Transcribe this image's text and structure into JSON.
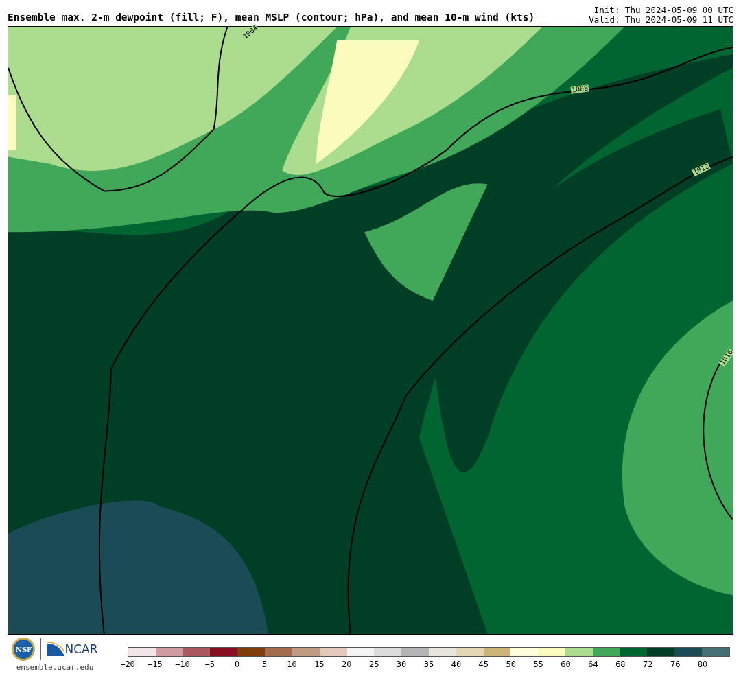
{
  "header": {
    "title": "Ensemble max. 2-m dewpoint (fill; F), mean MSLP (contour; hPa), and mean 10-m wind (kts)",
    "init": "Init: Thu 2024-05-09 00 UTC",
    "valid": "Valid: Thu 2024-05-09 11 UTC"
  },
  "map": {
    "contour_labels": [
      "1004",
      "1008",
      "1012",
      "1016"
    ]
  },
  "footer": {
    "nsf_logo": "NSF",
    "ncar_logo": "NCAR",
    "site": "ensemble.ucar.edu"
  },
  "colorbar": {
    "segments": [
      {
        "color": "#f3e6e8"
      },
      {
        "color": "#cf9aa0"
      },
      {
        "color": "#a85a5f"
      },
      {
        "color": "#870f1f"
      },
      {
        "color": "#7f3c0c"
      },
      {
        "color": "#a36c4a"
      },
      {
        "color": "#c19a82"
      },
      {
        "color": "#e2c9bb"
      },
      {
        "color": "#f4f4f4"
      },
      {
        "color": "#dcdcdc"
      },
      {
        "color": "#b5b5b5"
      },
      {
        "color": "#e6e6dc"
      },
      {
        "color": "#e6d7b4"
      },
      {
        "color": "#cdb478"
      },
      {
        "color": "#fffedc"
      },
      {
        "color": "#fafcbe"
      },
      {
        "color": "#acdc8e"
      },
      {
        "color": "#41a85a"
      },
      {
        "color": "#006530"
      },
      {
        "color": "#003f26"
      },
      {
        "color": "#1b4b54"
      },
      {
        "color": "#447074"
      }
    ],
    "ticks": [
      "−20",
      "−15",
      "−10",
      "−5",
      "0",
      "5",
      "10",
      "15",
      "20",
      "25",
      "30",
      "35",
      "40",
      "45",
      "50",
      "55",
      "60",
      "64",
      "68",
      "72",
      "76",
      "80"
    ]
  }
}
